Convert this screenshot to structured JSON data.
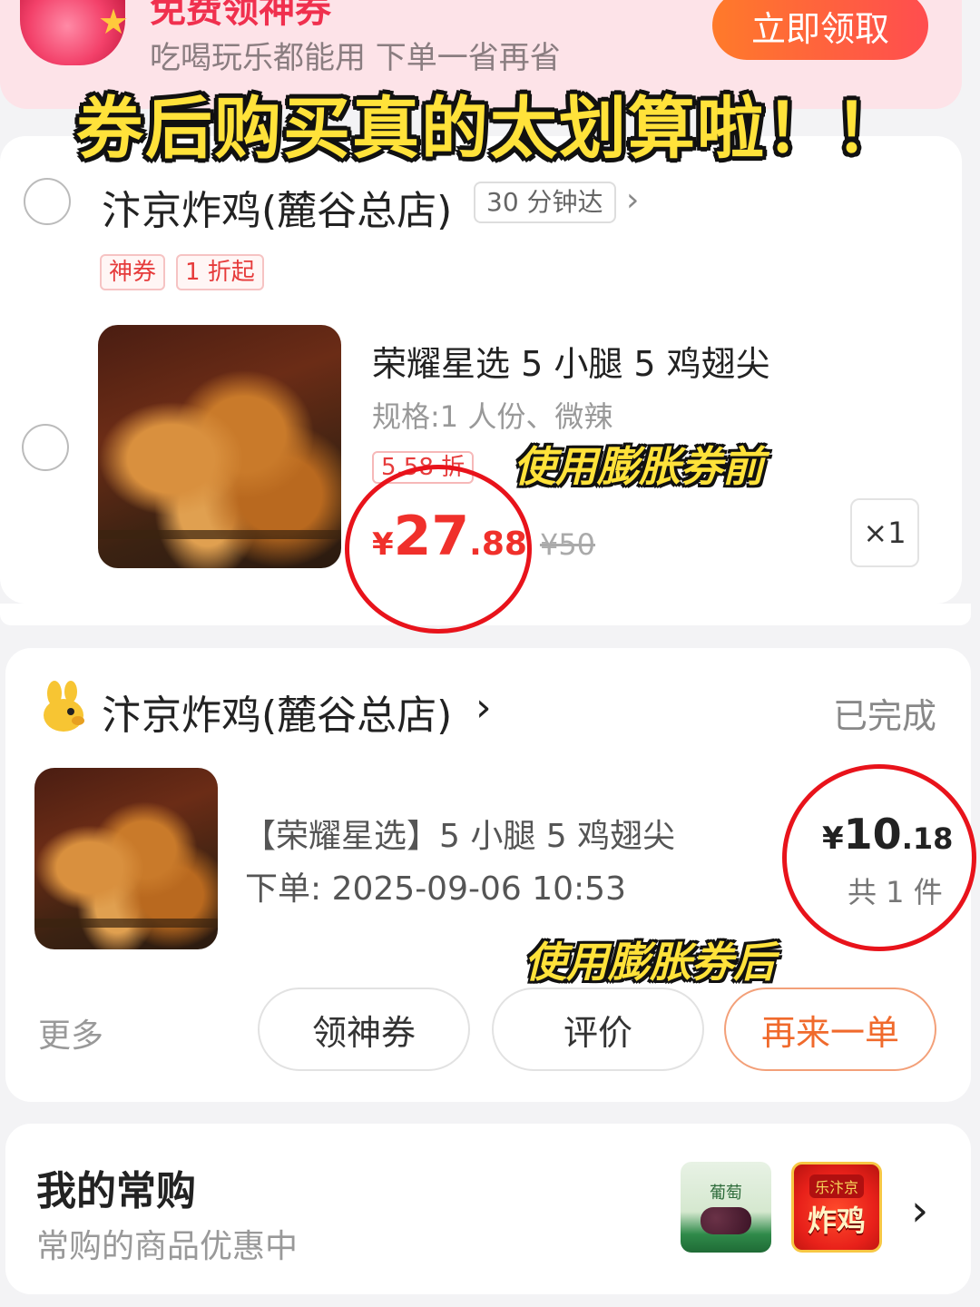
{
  "banner": {
    "title": "免费领神券",
    "subtitle": "吃喝玩乐都能用 下单一省再省",
    "claim_button": "立即领取"
  },
  "overlay_caption": "券后购买真的太划算啦！！",
  "cart_item": {
    "store_name": "汴京炸鸡(麓谷总店)",
    "eta": "30 分钟达",
    "tags": [
      "神券",
      "1 折起"
    ],
    "product_name": "荣耀星选 5 小腿 5 鸡翅尖",
    "spec": "规格:1 人份、微辣",
    "discount": "5.58 折",
    "price_symbol": "¥",
    "price_int": "27",
    "price_dec": ".88",
    "original_price": "¥50",
    "quantity": "×1",
    "caption": "使用膨胀券前"
  },
  "order": {
    "store_name": "汴京炸鸡(麓谷总店)",
    "status": "已完成",
    "product_name": "【荣耀星选】5 小腿 5 鸡翅尖",
    "order_time": "下单: 2025-09-06 10:53",
    "price_symbol": "¥",
    "price_int": "10",
    "price_dec": ".18",
    "count": "共 1 件",
    "caption": "使用膨胀券后",
    "actions": {
      "more": "更多",
      "coupon": "领神券",
      "review": "评价",
      "reorder": "再来一单"
    }
  },
  "frequent": {
    "title": "我的常购",
    "subtitle": "常购的商品优惠中",
    "thumb1_text": "葡萄",
    "thumb2_top": "乐汴京",
    "thumb2_main": "炸鸡"
  },
  "colors": {
    "price_red": "#f0302b",
    "accent_orange": "#f06a2c",
    "circle_red": "#e8131b",
    "caption_yellow": "#ffe23a"
  },
  "icons": [
    "radio-icon",
    "chevron-right-icon",
    "store-logo-icon",
    "shopping-bag-icon",
    "star-icon"
  ]
}
